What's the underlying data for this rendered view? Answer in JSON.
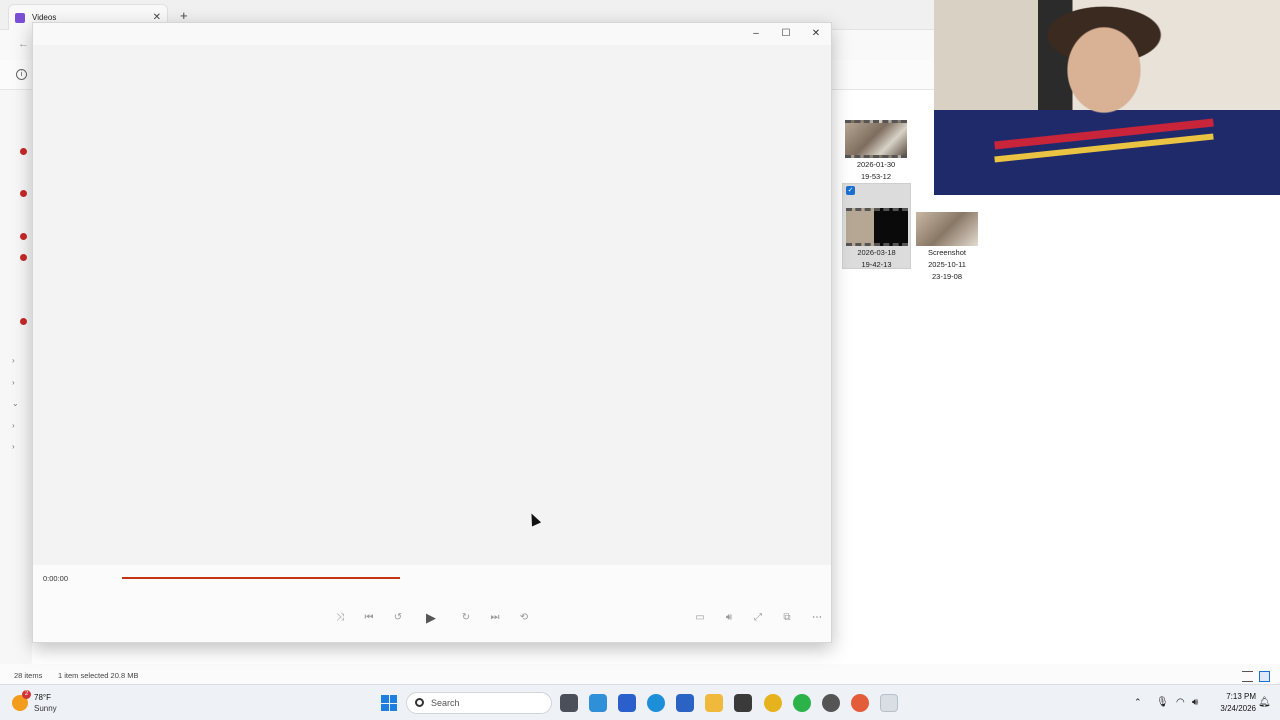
{
  "explorer": {
    "tab_label": "Videos",
    "tab_close": "✕",
    "new_tab": "+",
    "back_arrow": "←",
    "info_icon": "i",
    "thumbnails": [
      {
        "line1": "2026-01-30",
        "line2": "19-53-12",
        "line3": ""
      },
      {
        "line1": "2026-03-18",
        "line2": "19-42-13",
        "line3": "",
        "selected": true
      },
      {
        "line1": "Screenshot",
        "line2": "2025-10-11",
        "line3": "23-19-08"
      }
    ],
    "status": {
      "item_count": "28 items",
      "selection": "1 item selected  20.8 MB"
    }
  },
  "player": {
    "minimize": "–",
    "maximize": "☐",
    "close": "✕",
    "time": "0:00:00",
    "seek_progress": 0.403,
    "accent_color": "#c33414"
  },
  "taskbar": {
    "weather": {
      "badge": "2",
      "temp": "78°F",
      "condition": "Sunny",
      "icon": "sun-icon"
    },
    "search_placeholder": "Search",
    "clock": {
      "time": "7:13 PM",
      "date": "3/24/2026"
    },
    "tray_chevron": "⌃"
  }
}
